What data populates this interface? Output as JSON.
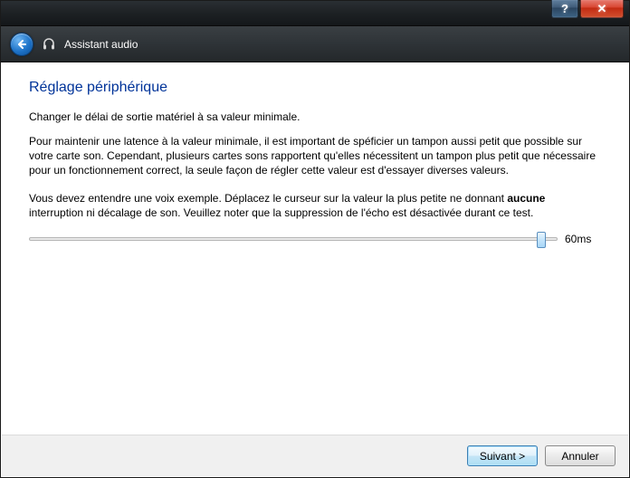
{
  "titlebar": {
    "help_glyph": "?",
    "close_glyph": "✕"
  },
  "header": {
    "title": "Assistant audio"
  },
  "page": {
    "title": "Réglage périphérique",
    "subtitle": "Changer le délai de sortie matériel à sa valeur minimale.",
    "para1": "Pour maintenir une latence à la valeur minimale, il est important de spéficier un tampon aussi petit que possible sur votre carte son. Cependant, plusieurs cartes sons rapportent qu'elles nécessitent un tampon plus petit que nécessaire pour un fonctionnement correct, la seule façon de régler cette valeur est d'essayer diverses valeurs.",
    "para2_pre": "Vous devez entendre une voix exemple. Déplacez le curseur sur la valeur la plus petite ne donnant ",
    "para2_bold": "aucune",
    "para2_post": " interruption ni décalage de son. Veuillez noter que la suppression de l'écho est désactivée durant ce test."
  },
  "slider": {
    "value_label": "60ms",
    "position_percent": 97
  },
  "footer": {
    "next_label": "Suivant >",
    "cancel_label": "Annuler"
  }
}
